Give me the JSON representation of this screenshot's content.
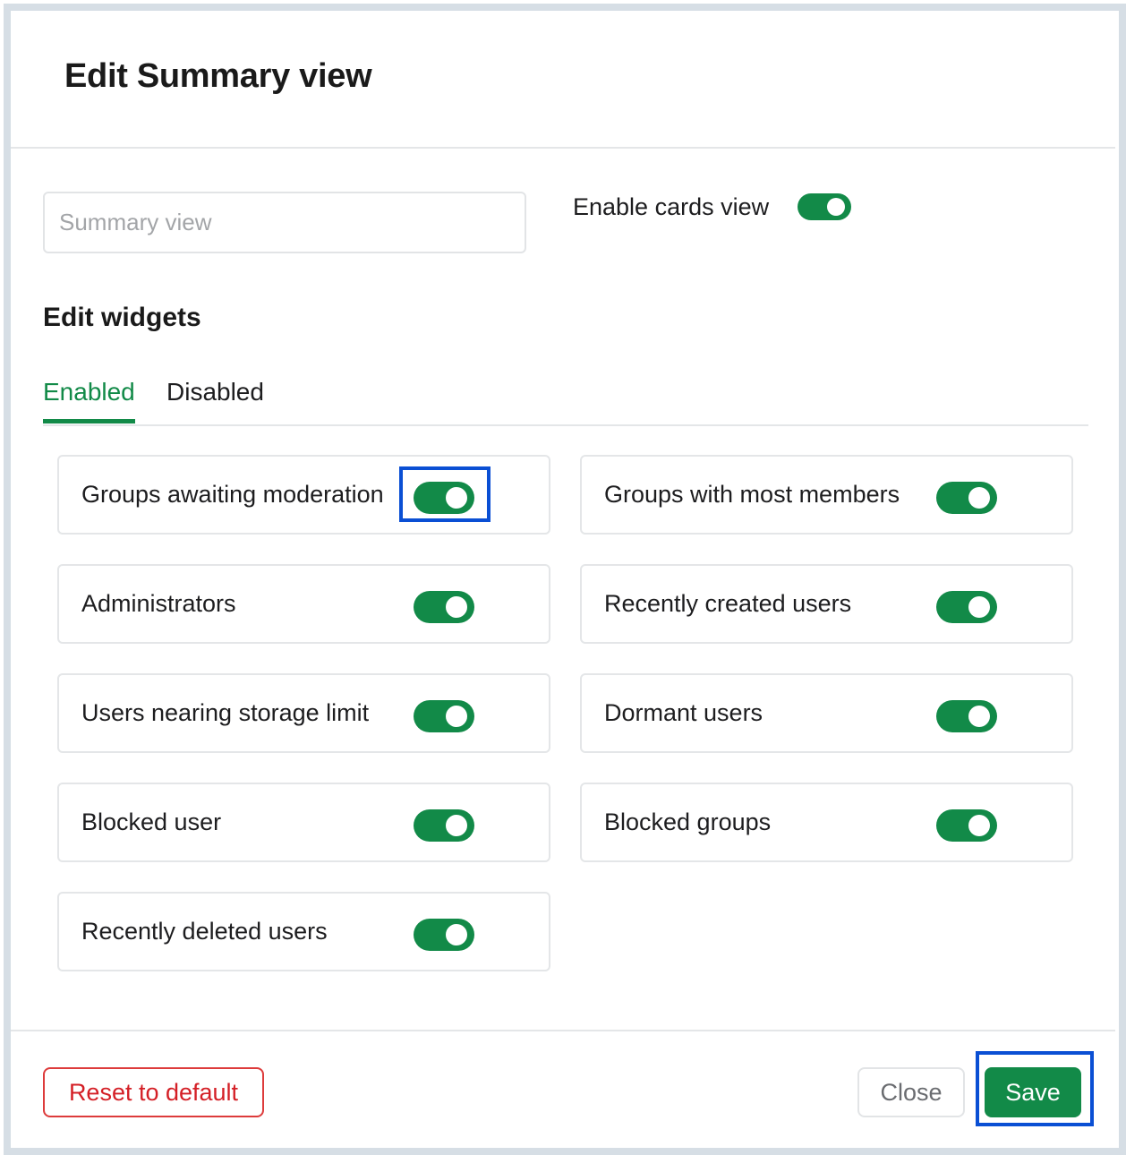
{
  "dialog": {
    "title": "Edit Summary view"
  },
  "view_name": {
    "value": "",
    "placeholder": "Summary view"
  },
  "cards_view": {
    "label": "Enable cards view",
    "enabled": true
  },
  "widgets": {
    "section_title": "Edit widgets",
    "tabs": [
      {
        "label": "Enabled",
        "active": true
      },
      {
        "label": "Disabled",
        "active": false
      }
    ],
    "items": [
      {
        "label": "Groups awaiting moderation",
        "enabled": true,
        "highlighted": true
      },
      {
        "label": "Groups with most members",
        "enabled": true
      },
      {
        "label": "Administrators",
        "enabled": true
      },
      {
        "label": "Recently created users",
        "enabled": true
      },
      {
        "label": "Users nearing storage limit",
        "enabled": true
      },
      {
        "label": "Dormant users",
        "enabled": true
      },
      {
        "label": "Blocked user",
        "enabled": true
      },
      {
        "label": "Blocked groups",
        "enabled": true
      },
      {
        "label": "Recently deleted users",
        "enabled": true
      }
    ]
  },
  "footer": {
    "reset_label": "Reset to default",
    "close_label": "Close",
    "save_label": "Save"
  },
  "colors": {
    "accent": "#128a48",
    "danger": "#d41f26",
    "highlight": "#0a4fd4"
  }
}
